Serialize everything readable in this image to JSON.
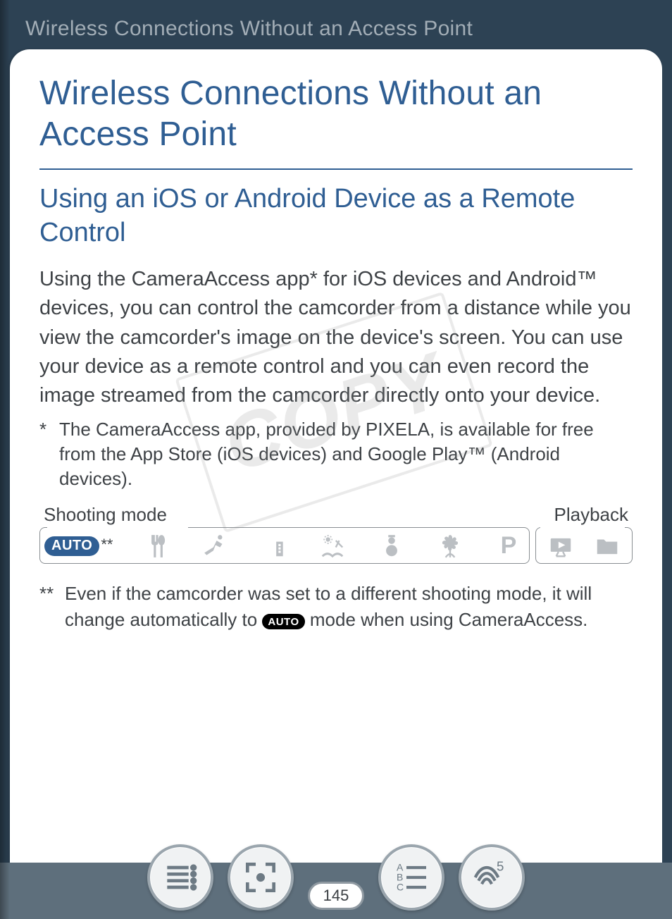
{
  "header": {
    "section_title": "Wireless Connections Without an Access Point"
  },
  "page": {
    "title": "Wireless Connections Without an Access Point",
    "subtitle": "Using an iOS or Android Device as a Remote Control",
    "body": "Using the CameraAccess app* for iOS devices and Android™ devices, you can control the camcorder from a distance while you view the camcorder's image on the device's screen. You can use your device as a remote control and you can even record the image streamed from the camcorder directly onto your device.",
    "footnote1_mark": "*",
    "footnote1_text": "The CameraAccess app, provided by PIXELA, is available for free from the App Store (iOS devices) and Google Play™ (Android devices).",
    "modes": {
      "shooting_label": "Shooting mode",
      "playback_label": "Playback",
      "auto_label": "AUTO",
      "auto_stars": "**",
      "p_label": "P"
    },
    "footnote2_mark": "**",
    "footnote2_before": "Even if the camcorder was set to a different shooting mode, it will change automatically to ",
    "footnote2_badge": "AUTO",
    "footnote2_after": " mode when using CameraAccess.",
    "watermark": "COPY"
  },
  "nav": {
    "page_number": "145",
    "wifi_badge": "5"
  }
}
